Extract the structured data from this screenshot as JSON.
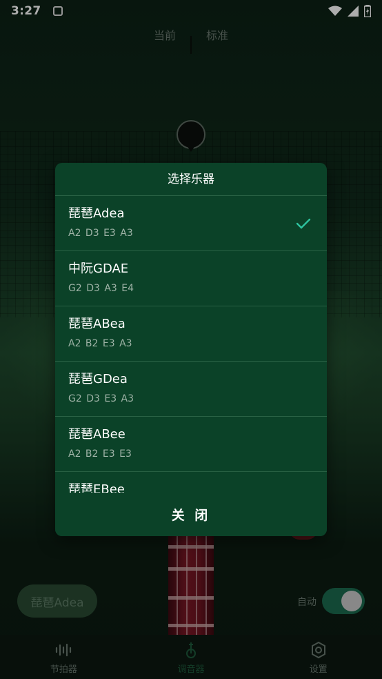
{
  "status_bar": {
    "time": "3:27"
  },
  "tuner": {
    "left_label": "当前",
    "right_label": "标准"
  },
  "bottom_controls": {
    "instrument_chip": "琵琶Adea",
    "auto_label": "自动",
    "auto_enabled": true
  },
  "bottom_nav": {
    "items": [
      {
        "label": "节拍器",
        "icon": "metronome-icon"
      },
      {
        "label": "调音器",
        "icon": "tuner-icon"
      },
      {
        "label": "设置",
        "icon": "gear-icon"
      }
    ],
    "active_index": 1
  },
  "dialog": {
    "title": "选择乐器",
    "items": [
      {
        "name": "琵琶Adea",
        "tuning": "A2  D3 E3  A3",
        "selected": true
      },
      {
        "name": "中阮GDAE",
        "tuning": "G2  D3 A3  E4",
        "selected": false
      },
      {
        "name": "琵琶ABea",
        "tuning": "A2  B2 E3  A3",
        "selected": false
      },
      {
        "name": "琵琶GDea",
        "tuning": "G2 D3 E3  A3",
        "selected": false
      },
      {
        "name": "琵琶ABee",
        "tuning": "A2  B2 E3  E3",
        "selected": false
      },
      {
        "name": "琵琶EBee",
        "tuning": "",
        "selected": false
      }
    ],
    "close_label": "关 闭"
  },
  "colors": {
    "dialog_bg": "#0b4228",
    "accent_check": "#2ec4a0",
    "toggle_on": "#1b6a4f"
  }
}
